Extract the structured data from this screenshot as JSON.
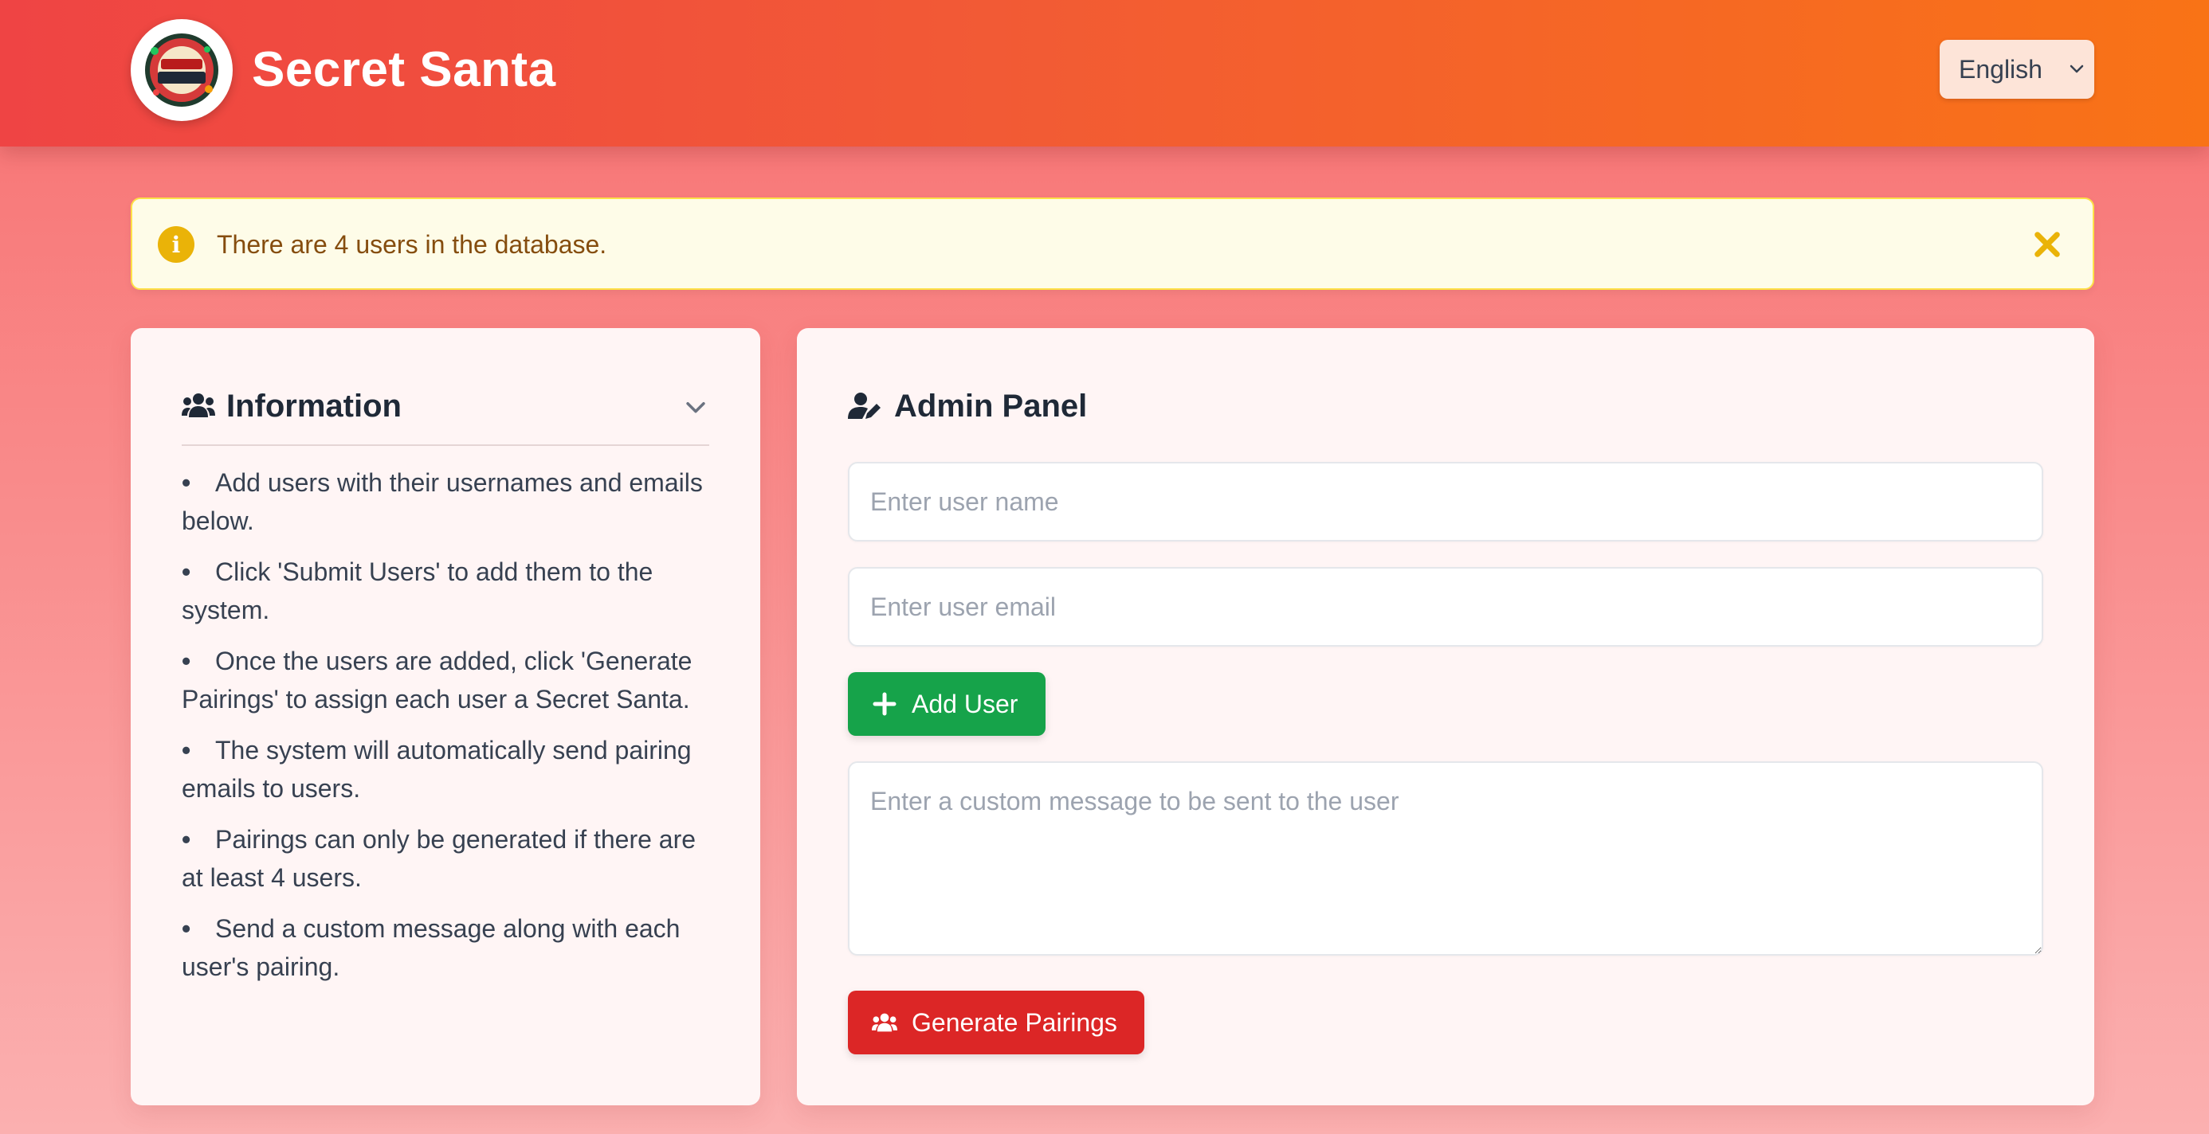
{
  "header": {
    "logo_text": "SECRET SANTA",
    "title": "Secret Santa",
    "language_select": {
      "value": "English",
      "icon": "chevron-down-icon"
    }
  },
  "alert": {
    "icon": "info-icon",
    "text": "There are 4 users in the database.",
    "close_icon": "close-icon",
    "colors": {
      "background": "#fefce8",
      "border": "#fde047",
      "icon": "#eab308",
      "text": "#854d0e"
    }
  },
  "info_panel": {
    "icon": "users-icon",
    "title": "Information",
    "toggle_icon": "chevron-down-icon",
    "items": [
      "Add users with their usernames and emails below.",
      "Click 'Submit Users' to add them to the system.",
      "Once the users are added, click 'Generate Pairings' to assign each user a Secret Santa.",
      "The system will automatically send pairing emails to users.",
      "Pairings can only be generated if there are at least 4 users.",
      "Send a custom message along with each user's pairing."
    ]
  },
  "admin_panel": {
    "icon": "user-edit-icon",
    "title": "Admin Panel",
    "name_input": {
      "value": "",
      "placeholder": "Enter user name"
    },
    "email_input": {
      "value": "",
      "placeholder": "Enter user email"
    },
    "add_user_button": {
      "label": "Add User",
      "icon": "plus-icon",
      "color": "#16a34a"
    },
    "message_input": {
      "value": "",
      "placeholder": "Enter a custom message to be sent to the user"
    },
    "generate_button": {
      "label": "Generate Pairings",
      "icon": "users-icon",
      "color": "#dc2626"
    }
  },
  "colors": {
    "header_start": "#ef4444",
    "header_end": "#f97316",
    "page_background": "#f87171",
    "card_background": "#fff5f5"
  }
}
